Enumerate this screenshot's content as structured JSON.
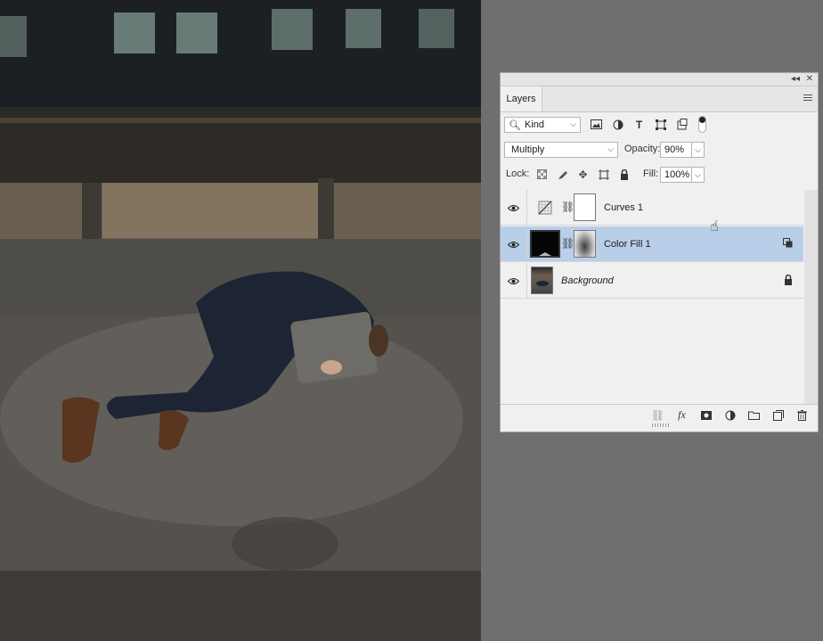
{
  "canvas": {
    "description_icon": "photo-canvas"
  },
  "panel": {
    "tab_label": "Layers",
    "collapse_icon": "double-chevron-left-icon",
    "close_icon": "close-icon",
    "menu_icon": "hamburger-menu-icon"
  },
  "filter": {
    "kind_label": "Kind",
    "icons": [
      "pixel-layer-filter-icon",
      "adjustment-layer-filter-icon",
      "type-layer-filter-icon",
      "shape-layer-filter-icon",
      "smart-object-filter-icon"
    ]
  },
  "blend": {
    "mode": "Multiply",
    "opacity_label": "Opacity:",
    "opacity_value": "90%",
    "lock_label": "Lock:",
    "fill_label": "Fill:",
    "fill_value": "100%"
  },
  "layers": [
    {
      "name": "Curves 1",
      "italic": false,
      "selected": false,
      "visible": true
    },
    {
      "name": "Color Fill 1",
      "italic": false,
      "selected": true,
      "visible": true
    },
    {
      "name": "Background",
      "italic": true,
      "selected": false,
      "visible": true,
      "locked": true
    }
  ],
  "footer": {
    "icons": [
      "link-layers-icon",
      "fx-icon",
      "add-mask-icon",
      "new-adjustment-icon",
      "new-group-icon",
      "new-layer-icon",
      "trash-icon"
    ]
  },
  "colors": {
    "selected_row": "#b9cfe9",
    "panel_bg": "#f0f0f0",
    "workspace_bg": "#6f6f6f"
  }
}
